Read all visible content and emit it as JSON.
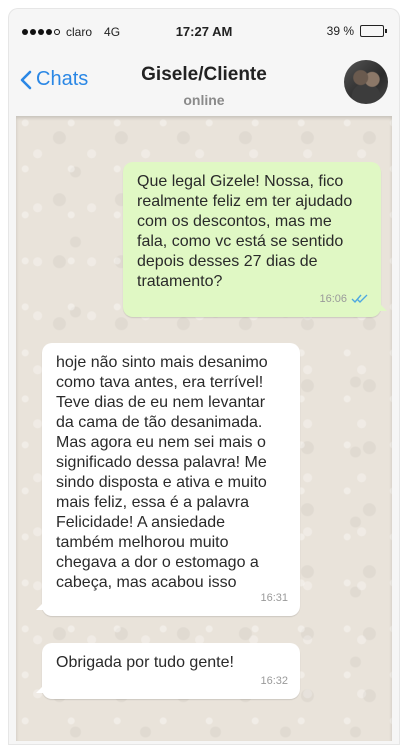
{
  "status_bar": {
    "carrier": "claro",
    "network": "4G",
    "time": "17:27 AM",
    "battery_text": "39 %",
    "battery_level": 0.39,
    "signal_bars": 4
  },
  "header": {
    "back_label": "Chats",
    "contact_name": "Gisele/Cliente",
    "presence": "online"
  },
  "messages": [
    {
      "direction": "outgoing",
      "text": "Que legal Gizele! Nossa, fico\nrealmente feliz em ter ajudado\ncom os descontos, mas me\nfala, como vc está se sentido\ndepois desses 27 dias de\ntratamento?",
      "time": "16:06",
      "status": "read"
    },
    {
      "direction": "incoming",
      "text": "hoje não sinto mais desanimo\ncomo tava antes, era terrível!\nTeve dias de eu nem levantar\nda cama de tão desanimada.\nMas agora eu nem sei mais o\nsignificado dessa palavra! Me\nsindo disposta e ativa e muito\nmais feliz, essa é a palavra\nFelicidade! A ansiedade\ntambém melhorou muito\nchegava a dor o estomago a\ncabeça, mas acabou isso",
      "time": "16:31"
    },
    {
      "direction": "incoming",
      "text": "Obrigada por tudo gente!",
      "time": "16:32"
    }
  ],
  "colors": {
    "accent": "#2a87e5",
    "outgoing_bubble": "#e0f8c4",
    "incoming_bubble": "#ffffff",
    "read_ticks": "#4fa8e0"
  }
}
